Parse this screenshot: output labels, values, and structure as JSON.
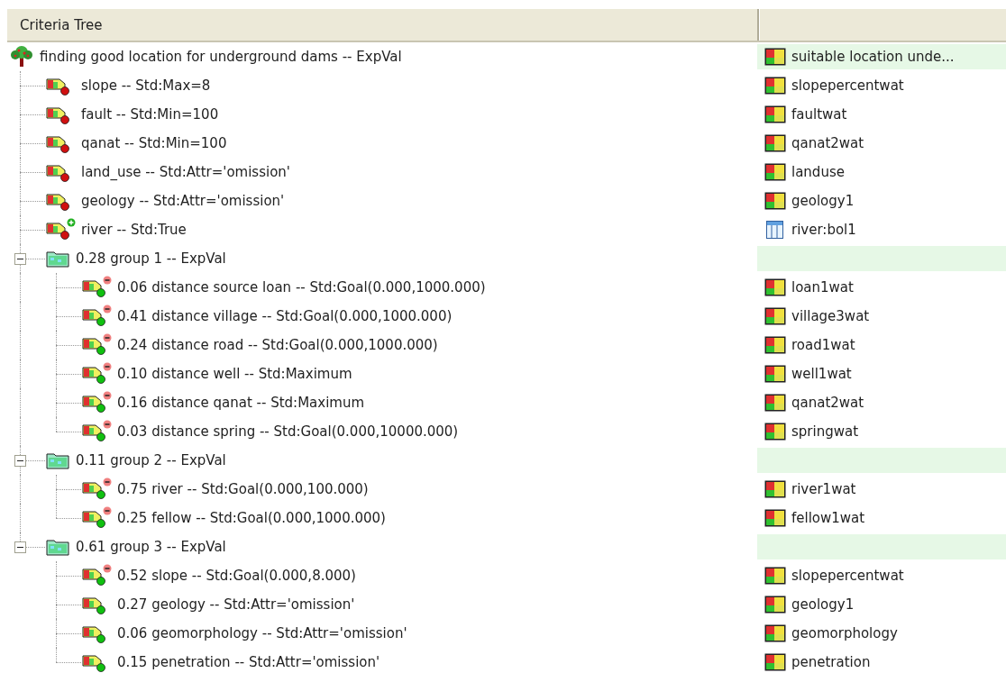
{
  "header": {
    "column_1": "Criteria Tree"
  },
  "tree": {
    "kind": "goal",
    "label": "finding good location for underground dams -- ExpVal",
    "highlighted": true,
    "layer": {
      "name": "suitable location unde...",
      "kind": "raster"
    },
    "children": [
      {
        "kind": "constraint",
        "plus_mark": false,
        "minus_mark": false,
        "label": "slope -- Std:Max=8",
        "highlighted": false,
        "layer": {
          "name": "slopepercentwat",
          "kind": "raster"
        }
      },
      {
        "kind": "constraint",
        "plus_mark": false,
        "minus_mark": false,
        "label": "fault -- Std:Min=100",
        "highlighted": false,
        "layer": {
          "name": "faultwat",
          "kind": "raster"
        }
      },
      {
        "kind": "constraint",
        "plus_mark": false,
        "minus_mark": false,
        "label": "qanat -- Std:Min=100",
        "highlighted": false,
        "layer": {
          "name": "qanat2wat",
          "kind": "raster"
        }
      },
      {
        "kind": "constraint",
        "plus_mark": false,
        "minus_mark": false,
        "label": "land_use -- Std:Attr='omission'",
        "highlighted": false,
        "layer": {
          "name": "landuse",
          "kind": "raster"
        }
      },
      {
        "kind": "constraint",
        "plus_mark": false,
        "minus_mark": false,
        "label": "geology -- Std:Attr='omission'",
        "highlighted": false,
        "layer": {
          "name": "geology1",
          "kind": "raster"
        }
      },
      {
        "kind": "constraint",
        "plus_mark": true,
        "minus_mark": false,
        "label": "river -- Std:True",
        "highlighted": false,
        "layer": {
          "name": "river:bol1",
          "kind": "table"
        }
      },
      {
        "kind": "group",
        "label": "0.28 group 1 -- ExpVal",
        "highlighted": true,
        "expanded": true,
        "children": [
          {
            "kind": "factor",
            "plus_mark": false,
            "minus_mark": true,
            "label": "0.06 distance source loan -- Std:Goal(0.000,1000.000)",
            "highlighted": false,
            "layer": {
              "name": "loan1wat",
              "kind": "raster"
            }
          },
          {
            "kind": "factor",
            "plus_mark": false,
            "minus_mark": true,
            "label": "0.41 distance village -- Std:Goal(0.000,1000.000)",
            "highlighted": false,
            "layer": {
              "name": "village3wat",
              "kind": "raster"
            }
          },
          {
            "kind": "factor",
            "plus_mark": false,
            "minus_mark": true,
            "label": "0.24 distance road -- Std:Goal(0.000,1000.000)",
            "highlighted": false,
            "layer": {
              "name": "road1wat",
              "kind": "raster"
            }
          },
          {
            "kind": "factor",
            "plus_mark": false,
            "minus_mark": true,
            "label": "0.10 distance well -- Std:Maximum",
            "highlighted": false,
            "layer": {
              "name": "well1wat",
              "kind": "raster"
            }
          },
          {
            "kind": "factor",
            "plus_mark": false,
            "minus_mark": true,
            "label": "0.16 distance qanat -- Std:Maximum",
            "highlighted": false,
            "layer": {
              "name": "qanat2wat",
              "kind": "raster"
            }
          },
          {
            "kind": "factor",
            "plus_mark": false,
            "minus_mark": true,
            "label": "0.03 distance spring -- Std:Goal(0.000,10000.000)",
            "highlighted": false,
            "layer": {
              "name": "springwat",
              "kind": "raster"
            }
          }
        ]
      },
      {
        "kind": "group",
        "label": "0.11 group 2 -- ExpVal",
        "highlighted": true,
        "expanded": true,
        "children": [
          {
            "kind": "factor",
            "plus_mark": false,
            "minus_mark": true,
            "label": "0.75 river -- Std:Goal(0.000,100.000)",
            "highlighted": false,
            "layer": {
              "name": "river1wat",
              "kind": "raster"
            }
          },
          {
            "kind": "factor",
            "plus_mark": false,
            "minus_mark": true,
            "label": "0.25 fellow -- Std:Goal(0.000,1000.000)",
            "highlighted": false,
            "layer": {
              "name": "fellow1wat",
              "kind": "raster"
            }
          }
        ]
      },
      {
        "kind": "group",
        "label": "0.61 group 3 -- ExpVal",
        "highlighted": true,
        "expanded": true,
        "children": [
          {
            "kind": "factor",
            "plus_mark": false,
            "minus_mark": true,
            "label": "0.52 slope -- Std:Goal(0.000,8.000)",
            "highlighted": false,
            "layer": {
              "name": "slopepercentwat",
              "kind": "raster"
            }
          },
          {
            "kind": "factor",
            "plus_mark": false,
            "minus_mark": false,
            "label": "0.27 geology -- Std:Attr='omission'",
            "highlighted": false,
            "layer": {
              "name": "geology1",
              "kind": "raster"
            }
          },
          {
            "kind": "factor",
            "plus_mark": false,
            "minus_mark": false,
            "label": "0.06 geomorphology -- Std:Attr='omission'",
            "highlighted": false,
            "layer": {
              "name": "geomorphology",
              "kind": "raster"
            }
          },
          {
            "kind": "factor",
            "plus_mark": false,
            "minus_mark": false,
            "label": "0.15 penetration -- Std:Attr='omission'",
            "highlighted": false,
            "layer": {
              "name": "penetration",
              "kind": "raster"
            }
          }
        ]
      }
    ]
  }
}
